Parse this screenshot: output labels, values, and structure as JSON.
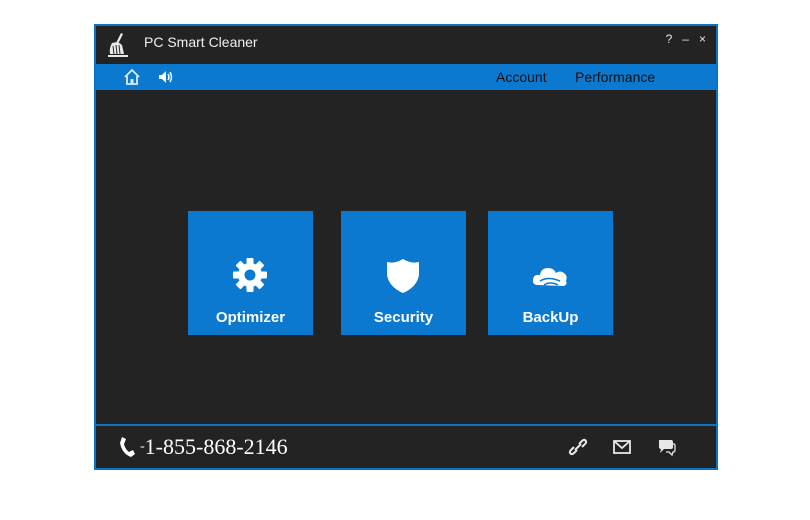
{
  "window": {
    "title": "PC Smart Cleaner",
    "controls": {
      "help": "?",
      "minimize": "–",
      "close": "×"
    }
  },
  "nav": {
    "left_icons": [
      "home-icon",
      "sound-icon"
    ],
    "links": {
      "account": "Account",
      "performance": "Performance"
    }
  },
  "tiles": [
    {
      "label": "Optimizer",
      "icon": "gear-icon"
    },
    {
      "label": "Security",
      "icon": "shield-icon"
    },
    {
      "label": "BackUp",
      "icon": "cloud-icon"
    }
  ],
  "footer": {
    "phone_prefix": "-",
    "phone_number": "1-855-868-2146",
    "icons": [
      "link-icon",
      "mail-icon",
      "chat-icon"
    ]
  },
  "colors": {
    "window_bg": "#232323",
    "accent": "#0a79cf",
    "border": "#0b74c6",
    "text": "#ffffff"
  }
}
